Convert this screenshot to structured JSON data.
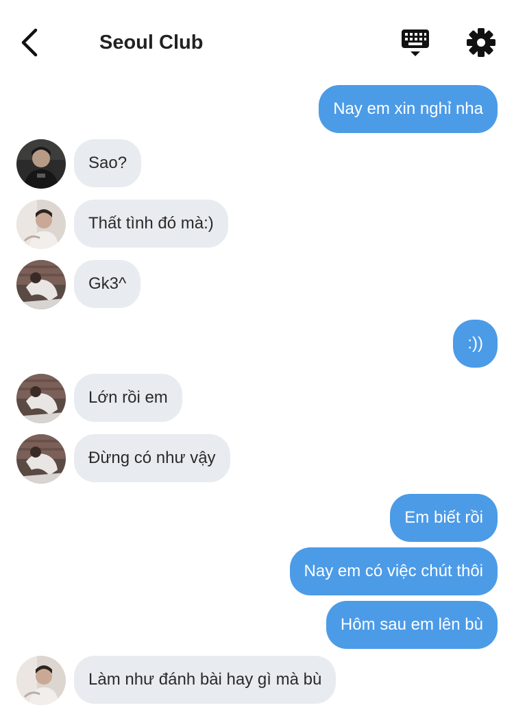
{
  "header": {
    "title": "Seoul Club",
    "back_icon": "chevron-left-icon",
    "keyboard_icon": "keyboard-icon",
    "settings_icon": "gear-icon"
  },
  "colors": {
    "outgoing_bubble": "#4c9be7",
    "incoming_bubble": "#e8ebef",
    "title_text": "#222222"
  },
  "messages": [
    {
      "direction": "out",
      "text": "Nay em xin nghỉ nha"
    },
    {
      "direction": "in",
      "text": "Sao?",
      "avatar": "dark"
    },
    {
      "direction": "in",
      "text": "Thất tình đó mà:)",
      "avatar": "light"
    },
    {
      "direction": "in",
      "text": "Gk3^",
      "avatar": "mixed"
    },
    {
      "direction": "out",
      "text": ":))"
    },
    {
      "direction": "in",
      "text": "Lớn rồi em",
      "avatar": "mixed"
    },
    {
      "direction": "in",
      "text": "Đừng có như vậy",
      "avatar": "mixed"
    },
    {
      "direction": "out",
      "text": "Em biết rồi"
    },
    {
      "direction": "out",
      "text": "Nay em có việc chút thôi"
    },
    {
      "direction": "out",
      "text": "Hôm sau em lên bù"
    },
    {
      "direction": "in",
      "text": "Làm như đánh bài hay gì mà bù",
      "avatar": "light"
    }
  ]
}
